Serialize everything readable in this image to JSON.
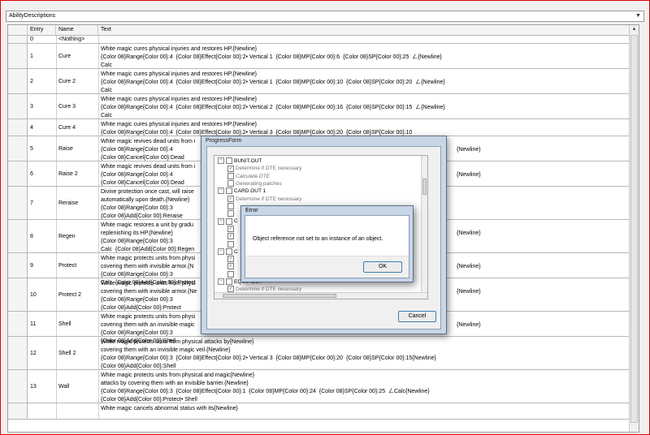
{
  "combo": {
    "value": "AbilityDescriptions"
  },
  "grid": {
    "columns": [
      "Entry",
      "Name",
      "Text"
    ],
    "rows": [
      {
        "entry": "0",
        "name": "<Nothing>",
        "lines": [
          ""
        ]
      },
      {
        "entry": "1",
        "name": "Cure",
        "lines": [
          "White magic cures physical injuries and restores HP.{Newline}",
          "{Color 08}Range{Color 00}:4  {Color 08}Effect{Color 00}:2• Vertical 1  {Color 08}MP{Color 00}:6  {Color 08}SP{Color 00}:25  ㄥ{Newline}",
          "Calc"
        ]
      },
      {
        "entry": "2",
        "name": "Cure 2",
        "lines": [
          "White magic cures physical injuries and restores HP.{Newline}",
          "{Color 08}Range{Color 00}:4  {Color 08}Effect{Color 00}:2• Vertical 1  {Color 08}MP{Color 00}:10  {Color 08}SP{Color 00}:20  ㄥ{Newline}",
          "Calc"
        ]
      },
      {
        "entry": "3",
        "name": "Cure 3",
        "lines": [
          "White magic cures physical injuries and restores HP.{Newline}",
          "{Color 08}Range{Color 00}:4  {Color 08}Effect{Color 00}:2• Vertical 2  {Color 08}MP{Color 00}:16  {Color 08}SP{Color 00}:15  ㄥ{Newline}",
          "Calc"
        ]
      },
      {
        "entry": "4",
        "name": "Cure 4",
        "lines": [
          "White magic cures physical injuries and restores HP.{Newline}",
          "{Color 08}Range{Color 00}:4  {Color 08}Effect{Color 00}:2• Vertical 3  {Color 08}MP{Color 00}:20  {Color 08}SP{Color 00}:10"
        ]
      },
      {
        "entry": "5",
        "name": "Raise",
        "lines": [
          "White magic revives dead units from i",
          "{Color 08}Range{Color 00}:4",
          "{Color 08}Cancel{Color 00}:Dead"
        ]
      },
      {
        "entry": "6",
        "name": "Raise 2",
        "lines": [
          "White magic revives dead units from i",
          "{Color 08}Range{Color 00}:4",
          "{Color 08}Cancel{Color 00}:Dead"
        ]
      },
      {
        "entry": "7",
        "name": "Reraise",
        "lines": [
          "Divine protection once cast, will raise",
          "automatically upon death.{Newline}",
          "{Color 08}Range{Color 00}:3",
          "{Color 08}Add{Color 00}:Reraise"
        ]
      },
      {
        "entry": "8",
        "name": "Regen",
        "lines": [
          "White magic restores a unit by gradu",
          "replenishing its HP.{Newline}",
          "{Color 08}Range{Color 00}:3",
          "Calc  {Color 08}Add{Color 00}:Regen"
        ]
      },
      {
        "entry": "9",
        "name": "Protect",
        "lines": [
          "White magic protects units from physi",
          "covering them with invisible armor.{N",
          "{Color 08}Range{Color 00}:3",
          "Calc  {Color 08}Add{Color 00}:Protect"
        ]
      },
      {
        "entry": "10",
        "name": "Protect 2",
        "lines": [
          "White magic protects units from physi",
          "covering them with invisible armor.{Ne",
          "{Color 08}Range{Color 00}:3",
          "{Color 08}Add{Color 00}:Protect"
        ]
      },
      {
        "entry": "11",
        "name": "Shell",
        "lines": [
          "White magic protects units from physi",
          "covering them with an invisible magic",
          "{Color 08}Range{Color 00}:3",
          "{Color 08}Add{Color 00}:Shell"
        ]
      },
      {
        "entry": "12",
        "name": "Shell 2",
        "lines": [
          "White magic protects units from physical attacks by{Newline}",
          "covering them with an invisible magic veil.{Newline}",
          "{Color 08}Range{Color 00}:3  {Color 08}Effect{Color 00}:2• Vertical 3  {Color 08}MP{Color 00}:20  {Color 08}SP{Color 00}:15{Newline}",
          "{Color 08}Add{Color 00}:Shell"
        ]
      },
      {
        "entry": "13",
        "name": "Wall",
        "lines": [
          "White magic protects units from physical and magic{Newline}",
          "attacks by covering them with an invisible barrier.{Newline}",
          "{Color 08}Range{Color 00}:3  {Color 08}Effect{Color 00}:1  {Color 08}MP{Color 00}:24  {Color 08}SP{Color 00}:25  ㄥCalc{Newline}",
          "{Color 08}Add{Color 00}:Protect• Shell"
        ]
      },
      {
        "entry": "",
        "name": "",
        "lines": [
          "White magic cancels abnormal status with its{Newline}"
        ]
      }
    ],
    "right_fragments": [
      {
        "row": 5,
        "text": "{Newline}"
      },
      {
        "row": 6,
        "text": "{Newline}"
      },
      {
        "row": 8,
        "text": "{Newline}"
      },
      {
        "row": 9,
        "text": "{Newline}"
      },
      {
        "row": 10,
        "text": "{Newline}"
      },
      {
        "row": 11,
        "text": "{Newline}"
      }
    ]
  },
  "progress_form": {
    "title": "ProgressForm",
    "tree": [
      {
        "label": "BUNIT.OUT",
        "level": 0,
        "checked": false,
        "expander": "−"
      },
      {
        "label": "Determine if DTE necessary",
        "level": 1,
        "checked": true
      },
      {
        "label": "Calculate DTE",
        "level": 1,
        "checked": false,
        "italic": true
      },
      {
        "label": "Generating patches",
        "level": 1,
        "checked": false
      },
      {
        "label": "CARD.OUT 1",
        "level": 0,
        "checked": false,
        "expander": "−"
      },
      {
        "label": "Determine if DTE necessary",
        "level": 1,
        "checked": true
      },
      {
        "label": "",
        "level": 1,
        "checked": false
      },
      {
        "label": "",
        "level": 1,
        "checked": false
      },
      {
        "label": "C",
        "level": 0,
        "checked": false,
        "expander": "−"
      },
      {
        "label": "",
        "level": 1,
        "checked": true
      },
      {
        "label": "",
        "level": 1,
        "checked": true
      },
      {
        "label": "",
        "level": 1,
        "checked": false
      },
      {
        "label": "C",
        "level": 0,
        "checked": false,
        "expander": "−"
      },
      {
        "label": "",
        "level": 1,
        "checked": true
      },
      {
        "label": "",
        "level": 1,
        "checked": true
      },
      {
        "label": "",
        "level": 1,
        "checked": false
      },
      {
        "label": "EQUIP.OUT",
        "level": 0,
        "checked": false,
        "expander": "−"
      },
      {
        "label": "Determine if DTE necessary",
        "level": 1,
        "checked": true
      }
    ],
    "cancel_label": "Cancel"
  },
  "error_dialog": {
    "title": "Error",
    "message": "Object reference not set to an instance of an object.",
    "ok_label": "OK"
  }
}
